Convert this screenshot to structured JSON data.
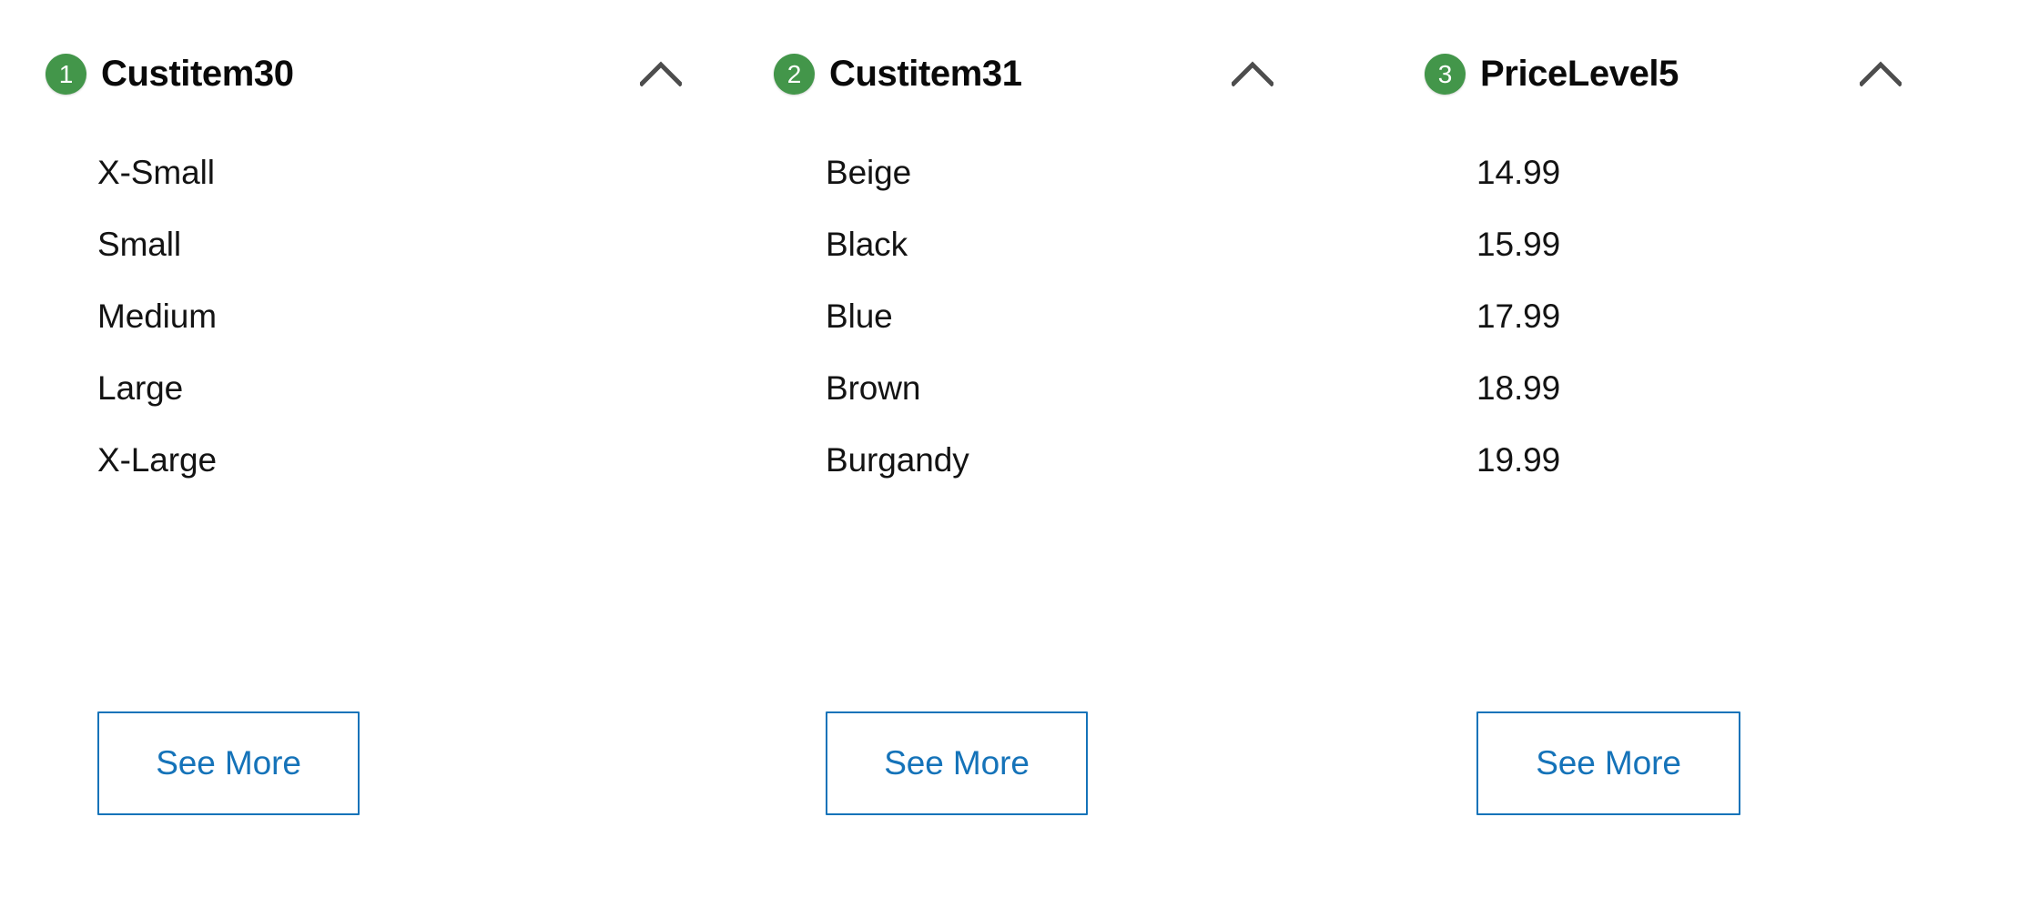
{
  "theme": {
    "background": "#ffffff",
    "badge_green": "#43964a",
    "badge_text": "#ffffff",
    "title_color": "#0a0a0a",
    "item_color": "#131313",
    "chevron_color": "#4d4d4d",
    "link_blue": "#1573b9"
  },
  "columns": [
    {
      "badge": "1",
      "title": "Custitem30",
      "collapse_icon": "chevron-up-icon",
      "options": [
        "X-Small",
        "Small",
        "Medium",
        "Large",
        "X-Large"
      ],
      "see_more_label": "See More"
    },
    {
      "badge": "2",
      "title": "Custitem31",
      "collapse_icon": "chevron-up-icon",
      "options": [
        "Beige",
        "Black",
        "Blue",
        "Brown",
        "Burgandy"
      ],
      "see_more_label": "See More"
    },
    {
      "badge": "3",
      "title": "PriceLevel5",
      "collapse_icon": "chevron-up-icon",
      "options": [
        "14.99",
        "15.99",
        "17.99",
        "18.99",
        "19.99"
      ],
      "see_more_label": "See More"
    }
  ]
}
